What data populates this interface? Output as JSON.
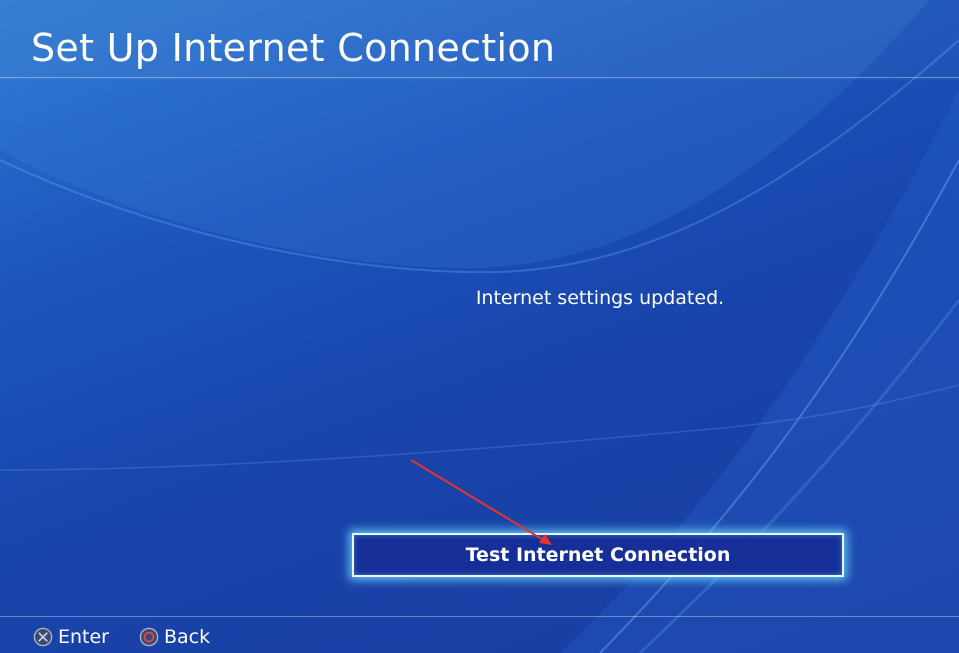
{
  "header": {
    "title": "Set Up Internet Connection"
  },
  "main": {
    "status_message": "Internet settings updated.",
    "test_button_label": "Test Internet Connection"
  },
  "footer": {
    "hints": [
      {
        "icon": "cross-button-icon",
        "label": "Enter"
      },
      {
        "icon": "circle-button-icon",
        "label": "Back"
      }
    ]
  },
  "colors": {
    "background": "#1c4fb8",
    "button_glow": "#6ed7ff",
    "circle_button": "#e0485a",
    "annotation_arrow": "#e8322c"
  }
}
